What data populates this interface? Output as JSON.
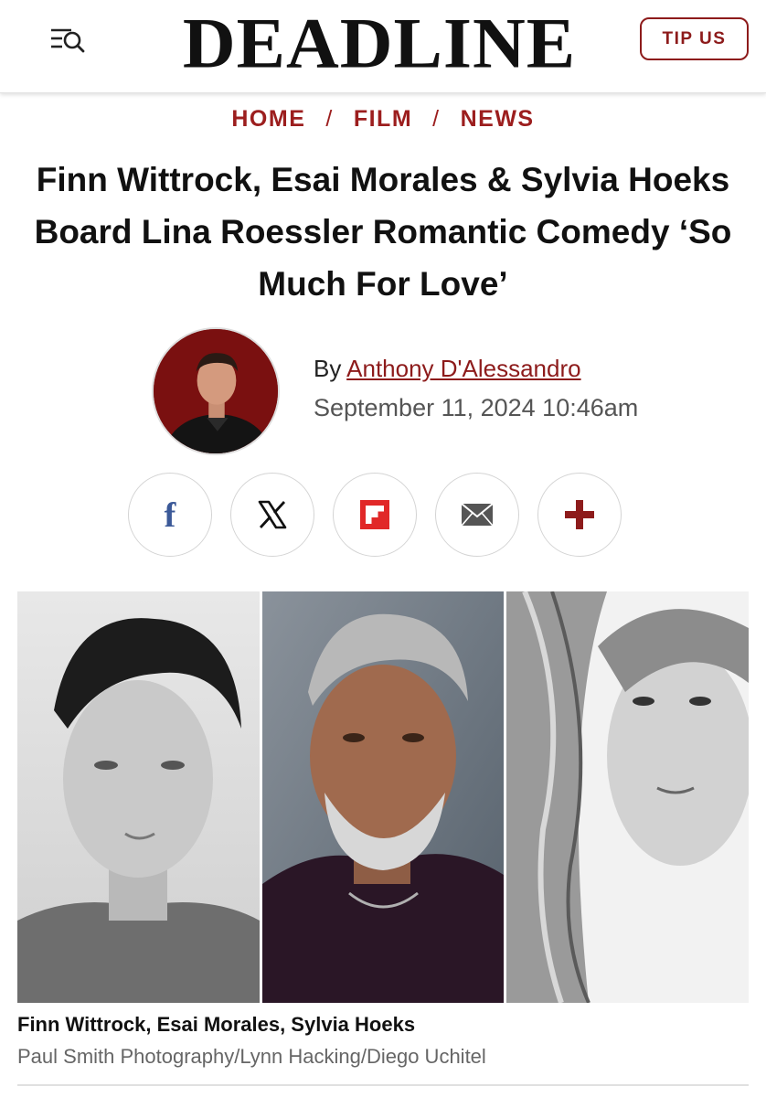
{
  "header": {
    "logo": "DEADLINE",
    "tip_label": "TIP US",
    "menu_icon": "menu-search-icon"
  },
  "breadcrumb": {
    "items": [
      "HOME",
      "FILM",
      "NEWS"
    ],
    "separator": "/"
  },
  "article": {
    "headline": "Finn Wittrock, Esai Morales & Sylvia Hoeks Board Lina Roessler Romantic Comedy ‘So Much For Love’",
    "by_label": "By",
    "author": "Anthony D'Alessandro",
    "date": "September 11, 2024 10:46am"
  },
  "share": {
    "buttons": [
      {
        "icon": "facebook-icon",
        "label": "f",
        "color": "#3b5998"
      },
      {
        "icon": "x-icon",
        "label": "X",
        "color": "#111111"
      },
      {
        "icon": "flipboard-icon",
        "label": "",
        "color": "#e12828"
      },
      {
        "icon": "email-icon",
        "label": "",
        "color": "#555555"
      },
      {
        "icon": "plus-icon",
        "label": "+",
        "color": "#8d1b1b"
      }
    ]
  },
  "image": {
    "caption": "Finn Wittrock, Esai Morales, Sylvia Hoeks",
    "credit": "Paul Smith Photography/Lynn Hacking/Diego Uchitel"
  },
  "colors": {
    "brand": "#8d1b1b",
    "text": "#111111",
    "muted": "#666666"
  }
}
